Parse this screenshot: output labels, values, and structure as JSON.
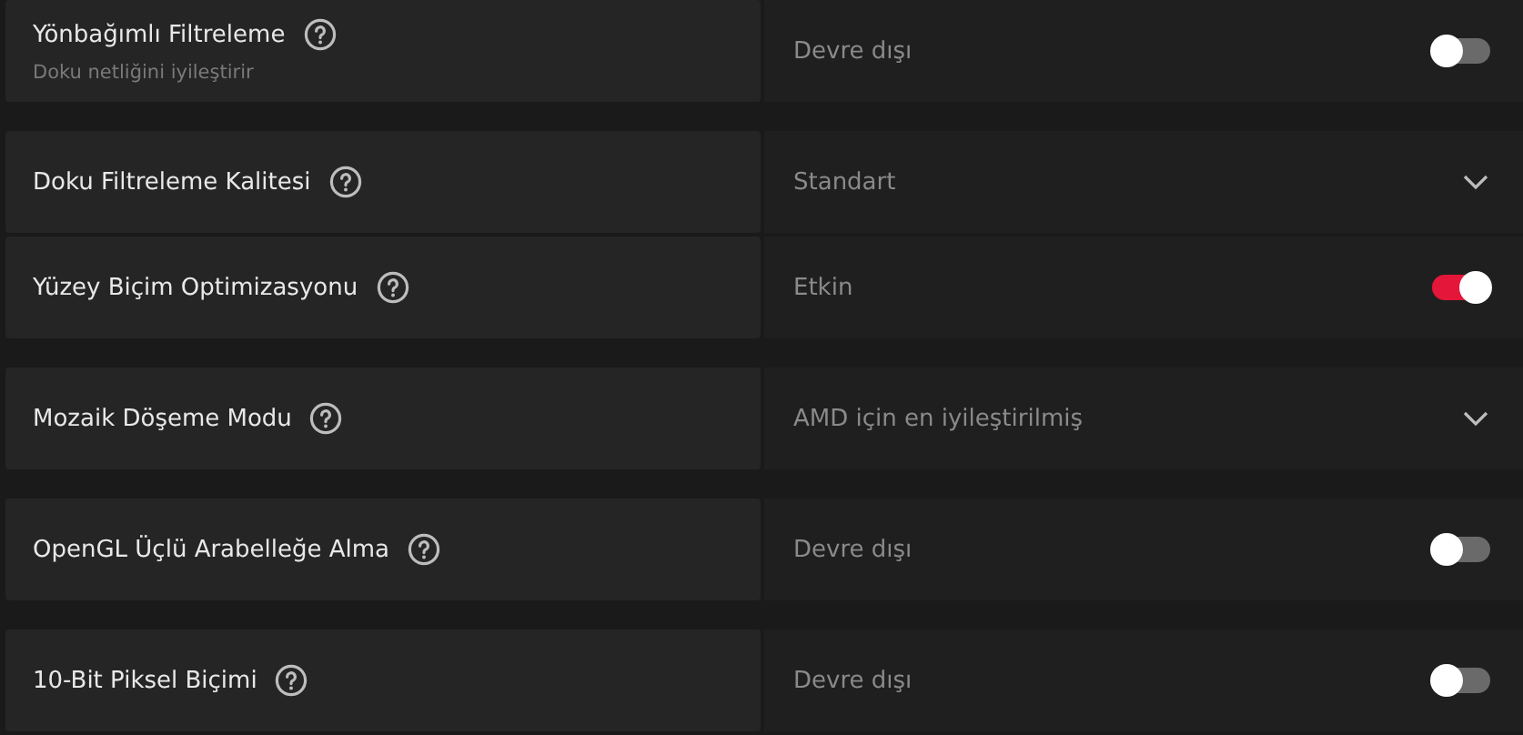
{
  "groups": [
    {
      "settings": [
        {
          "label": "Yönbağımlı Filtreleme",
          "description": "Doku netliğini iyileştirir",
          "kind": "toggle",
          "value": "Devre dışı",
          "on": false
        }
      ]
    },
    {
      "settings": [
        {
          "label": "Doku Filtreleme Kalitesi",
          "kind": "dropdown",
          "value": "Standart"
        },
        {
          "label": "Yüzey Biçim Optimizasyonu",
          "kind": "toggle",
          "value": "Etkin",
          "on": true
        }
      ]
    },
    {
      "settings": [
        {
          "label": "Mozaik Döşeme Modu",
          "kind": "dropdown",
          "value": "AMD için en iyileştirilmiş"
        }
      ]
    },
    {
      "settings": [
        {
          "label": "OpenGL Üçlü Arabelleğe Alma",
          "kind": "toggle",
          "value": "Devre dışı",
          "on": false
        }
      ]
    },
    {
      "settings": [
        {
          "label": "10-Bit Piksel Biçimi",
          "kind": "toggle",
          "value": "Devre dışı",
          "on": false
        }
      ]
    }
  ]
}
